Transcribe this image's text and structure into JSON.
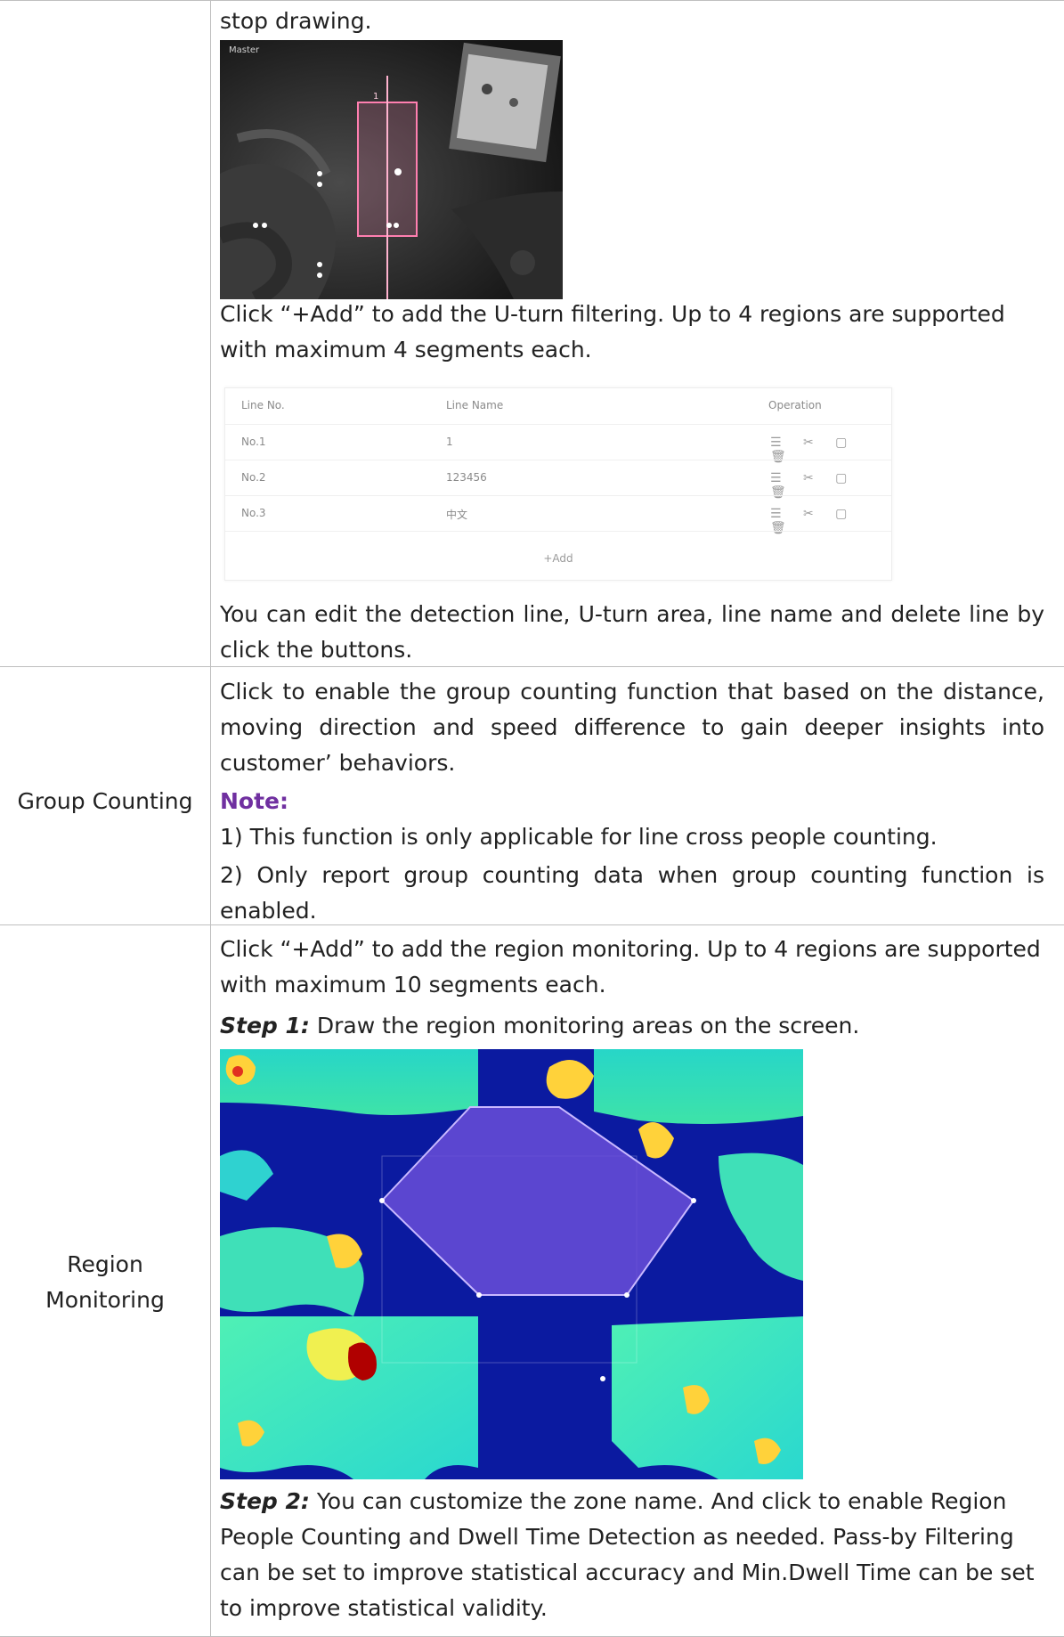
{
  "rows": {
    "u_turn": {
      "intro_fragment": "stop drawing.",
      "camera_caption": "Master",
      "add_text": "Click “+Add” to add the U-turn filtering. Up to 4 regions are supported with maximum 4 segments each.",
      "line_table": {
        "headers": [
          "Line No.",
          "Line Name",
          "Operation"
        ],
        "rows": [
          {
            "no": "No.1",
            "name": "1"
          },
          {
            "no": "No.2",
            "name": "123456"
          },
          {
            "no": "No.3",
            "name": "中文"
          }
        ],
        "add_label": "+Add"
      },
      "edit_text": "You can edit the detection line, U-turn area, line name and delete line by click the buttons."
    },
    "group_counting": {
      "label": "Group Counting",
      "description": "Click to enable the group counting function that based on the distance, moving direction and speed difference to gain deeper insights into customer’ behaviors.",
      "note_heading": "Note:",
      "note_1": "1)  This function is only applicable for line cross people counting.",
      "note_2": "2) Only report group counting data when group counting function is enabled."
    },
    "region_monitoring": {
      "label_line1": "Region",
      "label_line2": "Monitoring",
      "add_text": "Click “+Add” to add the region monitoring. Up to 4 regions are supported with maximum 10 segments each.",
      "step1_label": "Step 1:",
      "step1_text": " Draw the region monitoring areas on the screen.",
      "step2_label": "Step 2:",
      "step2_text": " You can customize the zone name. And click to enable Region People Counting and Dwell Time Detection as needed. Pass-by Filtering can be set to improve statistical accuracy and Min.Dwell Time can be set to improve statistical validity."
    }
  },
  "colors": {
    "note": "#7030a0",
    "border": "#bfbfbf",
    "region_fill": "#6a4fd8",
    "line_pink": "#ff7fb0"
  }
}
